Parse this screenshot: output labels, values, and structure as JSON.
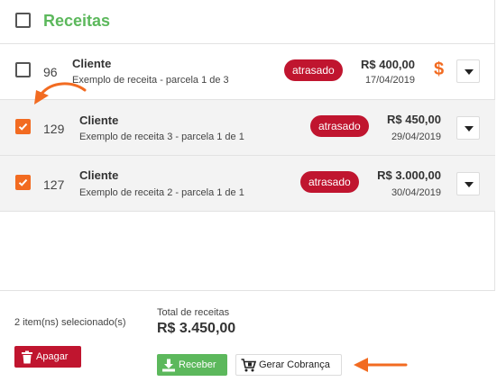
{
  "header": {
    "title": "Receitas"
  },
  "rows": [
    {
      "num": "96",
      "client": "Cliente",
      "desc": "Exemplo de receita - parcela 1 de 3",
      "status": "atrasado",
      "amount": "R$ 400,00",
      "date": "17/04/2019",
      "checked": false,
      "dollar": "$"
    },
    {
      "num": "129",
      "client": "Cliente",
      "desc": "Exemplo de receita 3 - parcela 1 de 1",
      "status": "atrasado",
      "amount": "R$ 450,00",
      "date": "29/04/2019",
      "checked": true
    },
    {
      "num": "127",
      "client": "Cliente",
      "desc": "Exemplo de receita 2 - parcela 1 de 1",
      "status": "atrasado",
      "amount": "R$ 3.000,00",
      "date": "30/04/2019",
      "checked": true
    }
  ],
  "footer": {
    "selected_count": "2 item(ns) selecionado(s)",
    "total_label": "Total de receitas",
    "total_value": "R$ 3.450,00",
    "delete_label": "Apagar",
    "receive_label": "Receber",
    "charge_label": "Gerar Cobrança"
  },
  "colors": {
    "accent": "#f26b21",
    "brand_green": "#5cb85c",
    "danger": "#c0152f"
  },
  "icons": [
    "trash-icon",
    "download-icon",
    "cart-icon",
    "chevron-down-icon",
    "dollar-icon",
    "check-icon",
    "arrow-annotation"
  ]
}
